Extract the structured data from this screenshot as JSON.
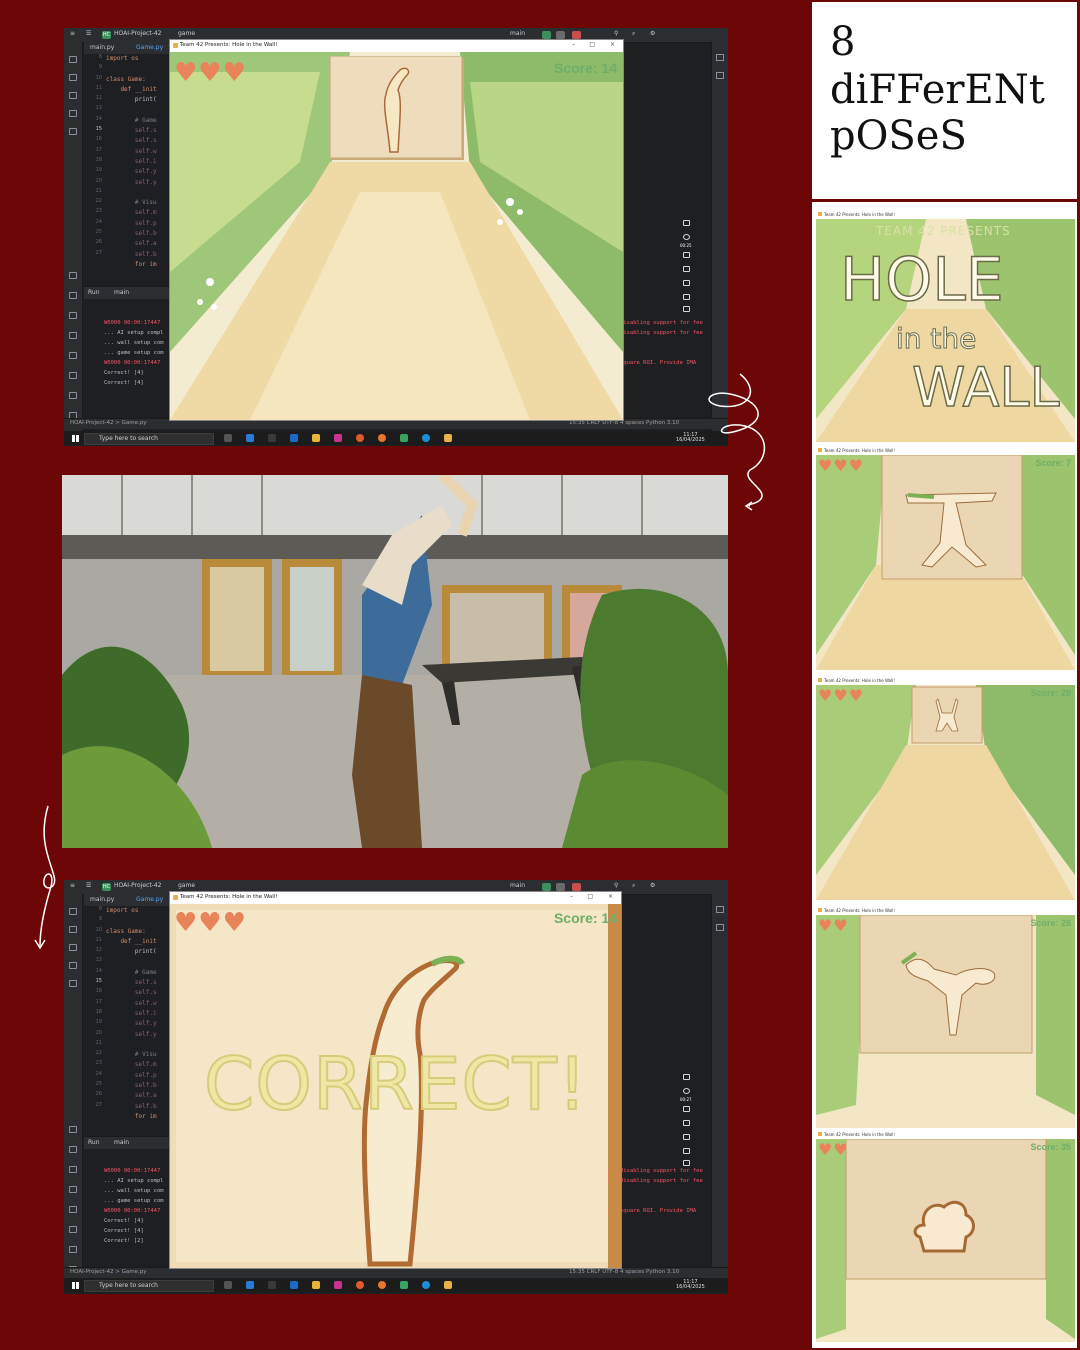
{
  "ide": {
    "project": "HOAI-Project-42",
    "project_badge": "HC",
    "branch": "game",
    "git_branch": "main",
    "tabs": [
      "main.py",
      "Game.py"
    ],
    "line_numbers": [
      "8",
      "9",
      "10",
      "11",
      "12",
      "13",
      "14",
      "15",
      "16",
      "17",
      "18",
      "19",
      "20",
      "21",
      "22",
      "23",
      "24",
      "25",
      "26",
      "27"
    ],
    "code_lines": [
      "import os",
      "",
      "class Game: ",
      "    def __init",
      "        print(",
      "",
      "        # Game",
      "        self.s",
      "        self.s",
      "        self.w",
      "        self.i",
      "        self.y",
      "        self.y",
      "",
      "        # Visu",
      "        self.m",
      "        self.p",
      "        self.b",
      "        self.a",
      "        self.b"
    ],
    "code_tail": "        for im",
    "run_tab": "Run",
    "run_config": "main",
    "console": [
      "W0000 00:00:17447",
      "... AI setup compl",
      "... wall setup com",
      "... game setup com",
      "W0000 00:00:17447",
      "Correct! [4]",
      "Correct! [4]"
    ],
    "console_bottom": [
      "W0000 00:00:17447",
      "... AI setup compl",
      "... wall setup com",
      "... game setup com",
      "W0000 00:00:17447",
      "Correct! [4]",
      "Correct! [4]",
      "Correct! [2]"
    ],
    "console_right": [
      "disabling support for fee",
      "disabling support for fee",
      "",
      "",
      "square ROI. Provide IMA"
    ],
    "breadcrumb": "HOAI-Project-42 > Game.py",
    "status": "15:35   CRLF   UTF-8   4 spaces   Python 3.10",
    "warnings": "1",
    "taskbar_search": "Type here to search",
    "clock_time": "11:17",
    "clock_date": "16/04/2025",
    "rec_time_top": "00:25",
    "rec_time_bottom": "00:27"
  },
  "game": {
    "window_title": "Team 42 Presents: Hole in the Wall!",
    "lives": "♥♥♥",
    "score_top": "Score: 14",
    "score_bottom": "Score: 14",
    "correct_text": "CORRECT!"
  },
  "title_card": {
    "line1": "8",
    "line2": "diFFerENt",
    "line3": "pOSeS"
  },
  "poses": [
    {
      "window_title": "Team 42 Presents: Hole in the Wall!",
      "presents": "TEAM 42 PRESENTS",
      "word1": "HOLE",
      "word2": "in the",
      "word3": "WALL"
    },
    {
      "window_title": "Team 42 Presents: Hole in the Wall!",
      "hearts": "♥♥♥",
      "score": "Score: 7"
    },
    {
      "window_title": "Team 42 Presents: Hole in the Wall!",
      "hearts": "♥♥♥",
      "score": "Score: 28"
    },
    {
      "window_title": "Team 42 Presents: Hole in the Wall!",
      "hearts": "♥♥",
      "score": "Score: 28"
    },
    {
      "window_title": "Team 42 Presents: Hole in the Wall!",
      "hearts": "♥♥",
      "score": "Score: 35"
    }
  ],
  "colors": {
    "background": "#6d0707",
    "heart": "#e8835a",
    "score": "#6fae69",
    "correct_fill": "#eee7a6"
  }
}
